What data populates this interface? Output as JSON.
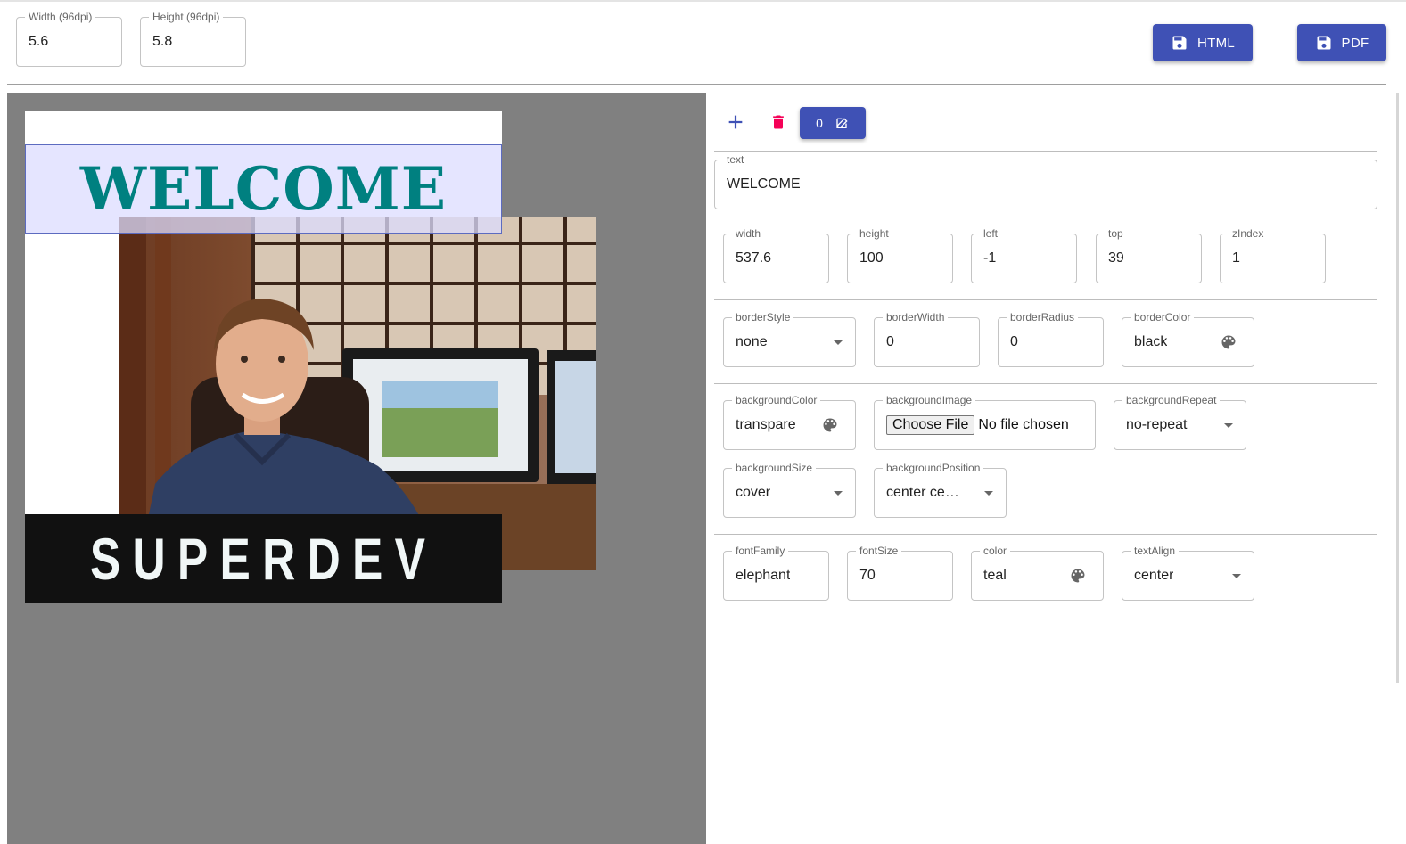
{
  "toolbar": {
    "width_label": "Width (96dpi)",
    "width_value": "5.6",
    "height_label": "Height (96dpi)",
    "height_value": "5.8",
    "html_button": "HTML",
    "pdf_button": "PDF"
  },
  "canvas": {
    "welcome_text": "WELCOME",
    "superdev_text": "SUPERDEV",
    "welcome_color": "#008080",
    "selection_color": "#5c6bc0"
  },
  "editor": {
    "counter": "0",
    "text": {
      "label": "text",
      "value": "WELCOME"
    },
    "width": {
      "label": "width",
      "value": "537.6"
    },
    "height": {
      "label": "height",
      "value": "100"
    },
    "left": {
      "label": "left",
      "value": "-1"
    },
    "top": {
      "label": "top",
      "value": "39"
    },
    "zIndex": {
      "label": "zIndex",
      "value": "1"
    },
    "borderStyle": {
      "label": "borderStyle",
      "value": "none"
    },
    "borderWidth": {
      "label": "borderWidth",
      "value": "0"
    },
    "borderRadius": {
      "label": "borderRadius",
      "value": "0"
    },
    "borderColor": {
      "label": "borderColor",
      "value": "black"
    },
    "backgroundColor": {
      "label": "backgroundColor",
      "value": "transpare"
    },
    "backgroundImage": {
      "label": "backgroundImage",
      "choose": "Choose File",
      "none": "No file chosen"
    },
    "backgroundRepeat": {
      "label": "backgroundRepeat",
      "value": "no-repeat"
    },
    "backgroundSize": {
      "label": "backgroundSize",
      "value": "cover"
    },
    "backgroundPosition": {
      "label": "backgroundPosition",
      "value": "center ce…"
    },
    "fontFamily": {
      "label": "fontFamily",
      "value": "elephant"
    },
    "fontSize": {
      "label": "fontSize",
      "value": "70"
    },
    "color": {
      "label": "color",
      "value": "teal"
    },
    "textAlign": {
      "label": "textAlign",
      "value": "center"
    }
  },
  "colors": {
    "primary": "#3f51b5",
    "delete": "#f50057",
    "canvas_bg": "#808080"
  }
}
